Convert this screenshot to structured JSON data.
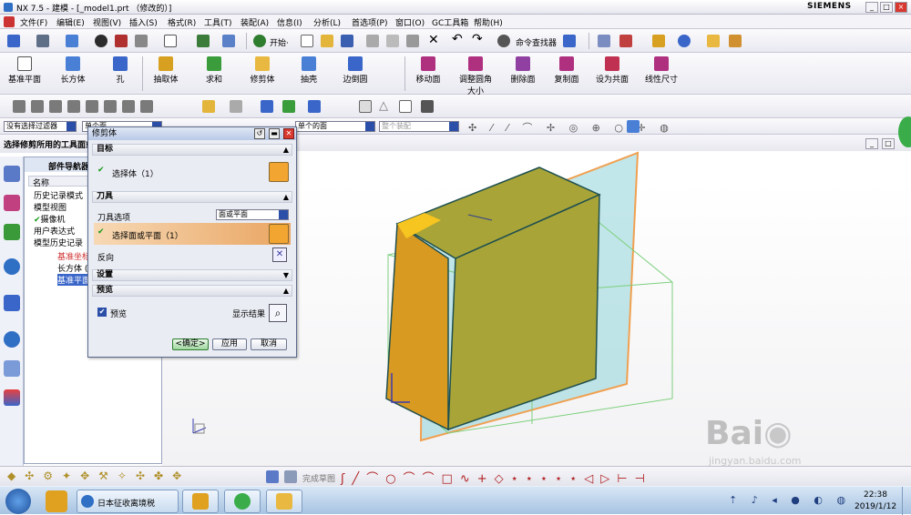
{
  "window": {
    "title": "NX 7.5 - 建模 - [_model1.prt （修改的）]",
    "brand": "SIEMENS"
  },
  "menu": [
    "文件(F)",
    "编辑(E)",
    "视图(V)",
    "插入(S)",
    "格式(R)",
    "工具(T)",
    "装配(A)",
    "信息(I)",
    "分析(L)",
    "首选项(P)",
    "窗口(O)",
    "GC工具箱",
    "帮助(H)"
  ],
  "toolbar1": {
    "start_label": "开始·",
    "command_finder": "命令查找器"
  },
  "toolbar2": [
    {
      "label": "基准平面"
    },
    {
      "label": "长方体"
    },
    {
      "label": "孔"
    },
    {
      "label": "抽取体"
    },
    {
      "label": "求和"
    },
    {
      "label": "修剪体"
    },
    {
      "label": "抽壳"
    },
    {
      "label": "边倒圆"
    },
    {
      "label": "移动面"
    },
    {
      "label": "调整圆角大小"
    },
    {
      "label": "删除面"
    },
    {
      "label": "复制面"
    },
    {
      "label": "设为共面"
    },
    {
      "label": "线性尺寸"
    }
  ],
  "filters": {
    "selection_filter": "没有选择过滤器",
    "face_rule": "单个面",
    "face_rule_right": "单个的面",
    "assembly": "整个装配"
  },
  "status_prompt": "选择修剪所用的工具面或基准平面",
  "nav": {
    "title": "部件导航器",
    "column": "名称",
    "items": [
      "历史记录模式",
      "模型视图",
      "摄像机",
      "用户表达式",
      "模型历史记录"
    ],
    "children": [
      "基准坐标系 (0)",
      "长方体 (1)",
      "基准平面 (2)"
    ]
  },
  "dialog": {
    "title": "修剪体",
    "target_header": "目标",
    "target_select": "选择体（1）",
    "tool_header": "刀具",
    "tool_option_label": "刀具选项",
    "tool_option_value": "面或平面",
    "tool_select": "选择面或平面（1）",
    "reverse": "反向",
    "settings_header": "设置",
    "preview_header": "预览",
    "preview_label": "预览",
    "show_result": "显示结果",
    "ok": "<确定>",
    "apply": "应用",
    "cancel": "取消"
  },
  "bottom_toolbar": {
    "finish_sketch": "完成草图"
  },
  "taskbar": {
    "ime": "日本征收离境税",
    "time": "22:38",
    "date": "2019/1/12"
  },
  "watermark": {
    "site": "jingyan.baidu.com"
  },
  "colors": {
    "body_orange": "#d99a22",
    "top_green": "#a8a438",
    "plane_teal": "#8fd3d8",
    "selection_orange": "#f0a050",
    "titlebar_red": "#d9382f"
  }
}
